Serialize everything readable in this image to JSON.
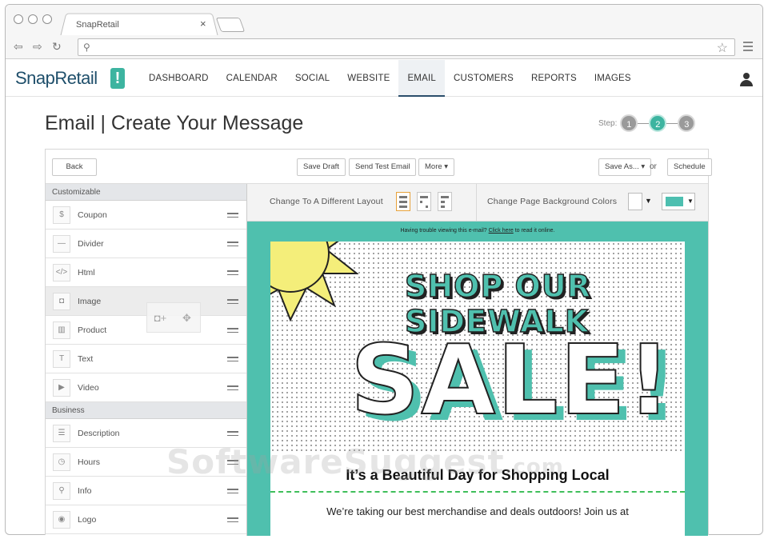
{
  "browser": {
    "tab_title": "SnapRetail",
    "tab_close": "×",
    "search_glyph": "⚲",
    "star_glyph": "☆"
  },
  "app": {
    "logo": "SnapRetail",
    "logo_mark": "!",
    "nav": [
      {
        "label": "DASHBOARD",
        "active": false
      },
      {
        "label": "CALENDAR",
        "active": false
      },
      {
        "label": "SOCIAL",
        "active": false
      },
      {
        "label": "WEBSITE",
        "active": false
      },
      {
        "label": "EMAIL",
        "active": true
      },
      {
        "label": "CUSTOMERS",
        "active": false
      },
      {
        "label": "REPORTS",
        "active": false
      },
      {
        "label": "IMAGES",
        "active": false
      }
    ]
  },
  "page": {
    "title": "Email | Create Your Message",
    "step_label": "Step:",
    "steps": [
      "1",
      "2",
      "3"
    ],
    "current_step": 2
  },
  "toolbar": {
    "back": "Back",
    "save_draft": "Save Draft",
    "send_test": "Send Test Email",
    "more": "More ▾",
    "save_as": "Save As... ▾",
    "or": "or",
    "schedule": "Schedule"
  },
  "sidebar": {
    "sections": [
      {
        "title": "Customizable",
        "items": [
          {
            "label": "Coupon",
            "icon": "coupon-icon",
            "glyph": "$"
          },
          {
            "label": "Divider",
            "icon": "divider-icon",
            "glyph": "—"
          },
          {
            "label": "Html",
            "icon": "html-icon",
            "glyph": "</>"
          },
          {
            "label": "Image",
            "icon": "camera-icon",
            "glyph": "◘"
          },
          {
            "label": "Product",
            "icon": "barcode-icon",
            "glyph": "▥"
          },
          {
            "label": "Text",
            "icon": "text-icon",
            "glyph": "T"
          },
          {
            "label": "Video",
            "icon": "video-icon",
            "glyph": "▶"
          }
        ]
      },
      {
        "title": "Business",
        "items": [
          {
            "label": "Description",
            "icon": "list-icon",
            "glyph": "☰"
          },
          {
            "label": "Hours",
            "icon": "clock-icon",
            "glyph": "◷"
          },
          {
            "label": "Info",
            "icon": "location-pin-icon",
            "glyph": "⚲"
          },
          {
            "label": "Logo",
            "icon": "logo-icon",
            "glyph": "◉"
          }
        ]
      }
    ],
    "hovered_item": "Image"
  },
  "layoutbar": {
    "change_layout_label": "Change To A Different Layout",
    "bg_colors_label": "Change Page Background Colors",
    "colors": {
      "page": "#ffffff",
      "accent": "#4fc0ae"
    }
  },
  "email": {
    "trouble_prefix": "Having trouble viewing this e-mail?",
    "trouble_link": "Click here",
    "trouble_suffix": "to read it online.",
    "banner_line1": "SHOP OUR",
    "banner_line2": "SIDEWALK",
    "banner_line3": "SALE!",
    "headline": "It’s a Beautiful Day for Shopping Local",
    "body": "We’re taking our best merchandise and deals outdoors! Join us at"
  },
  "watermark": {
    "main": "SoftwareSuggest",
    "suffix": ".com"
  }
}
